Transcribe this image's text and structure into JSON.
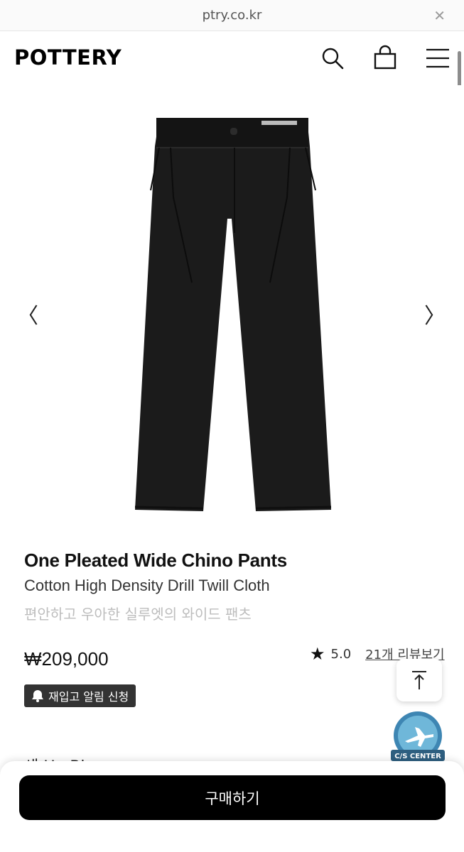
{
  "browser": {
    "url": "ptry.co.kr",
    "close_glyph": "✕"
  },
  "header": {
    "logo": "POTTERY",
    "icons": [
      "search-icon",
      "shopping-bag-icon",
      "menu-icon"
    ]
  },
  "gallery": {
    "prev_glyph": "〈",
    "next_glyph": "〉",
    "image": "black-pleated-wide-pants"
  },
  "product": {
    "title": "One Pleated Wide Chino Pants",
    "subtitle": "Cotton High Density Drill Twill Cloth",
    "description": "편안하고 우아한 실루엣의 와이드 팬츠",
    "price": "₩209,000",
    "rating": "5.0",
    "reviews_link": "21개 리뷰보기",
    "restock_button": "재입고 알림 신청"
  },
  "floating": {
    "scroll_top": "scroll-to-top-icon",
    "cs_label": "C/S CENTER"
  },
  "partial_text": "새 Ha   Bl",
  "footer": {
    "buy_button": "구매하기"
  },
  "colors": {
    "buy_button_bg": "#000000",
    "restock_bg": "#333333",
    "description": "#bdbdbd"
  }
}
